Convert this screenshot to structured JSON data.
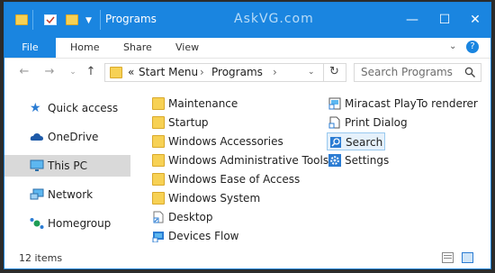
{
  "titlebar": {
    "title": "Programs",
    "watermark": "AskVG.com",
    "minimize": "—",
    "maximize": "☐",
    "close": "✕"
  },
  "ribbon": {
    "tabs": [
      "File",
      "Home",
      "Share",
      "View"
    ]
  },
  "address": {
    "prefix": "«",
    "path": [
      "Start Menu",
      "Programs"
    ],
    "separator": "›",
    "search_placeholder": "Search Programs"
  },
  "sidebar": {
    "items": [
      {
        "label": "Quick access",
        "icon": "star-icon",
        "selected": false
      },
      {
        "label": "OneDrive",
        "icon": "cloud-icon",
        "selected": false
      },
      {
        "label": "This PC",
        "icon": "monitor-icon",
        "selected": true
      },
      {
        "label": "Network",
        "icon": "network-icon",
        "selected": false
      },
      {
        "label": "Homegroup",
        "icon": "homegroup-icon",
        "selected": false
      }
    ]
  },
  "files": {
    "col1": [
      {
        "label": "Maintenance",
        "icon": "folder-icon"
      },
      {
        "label": "Startup",
        "icon": "folder-icon"
      },
      {
        "label": "Windows Accessories",
        "icon": "folder-icon"
      },
      {
        "label": "Windows Administrative Tools",
        "icon": "folder-icon"
      },
      {
        "label": "Windows Ease of Access",
        "icon": "folder-icon"
      },
      {
        "label": "Windows System",
        "icon": "folder-icon"
      },
      {
        "label": "Desktop",
        "icon": "shortcut-icon"
      },
      {
        "label": "Devices Flow",
        "icon": "devices-icon"
      }
    ],
    "col2": [
      {
        "label": "Miracast PlayTo renderer",
        "icon": "app-shortcut-icon"
      },
      {
        "label": "Print Dialog",
        "icon": "app-shortcut-icon"
      },
      {
        "label": "Search",
        "icon": "search-app-icon"
      },
      {
        "label": "Settings",
        "icon": "settings-gear-icon"
      }
    ]
  },
  "status": {
    "count": "12 items"
  },
  "colors": {
    "accent": "#1a85e0",
    "folder": "#f7d154"
  }
}
